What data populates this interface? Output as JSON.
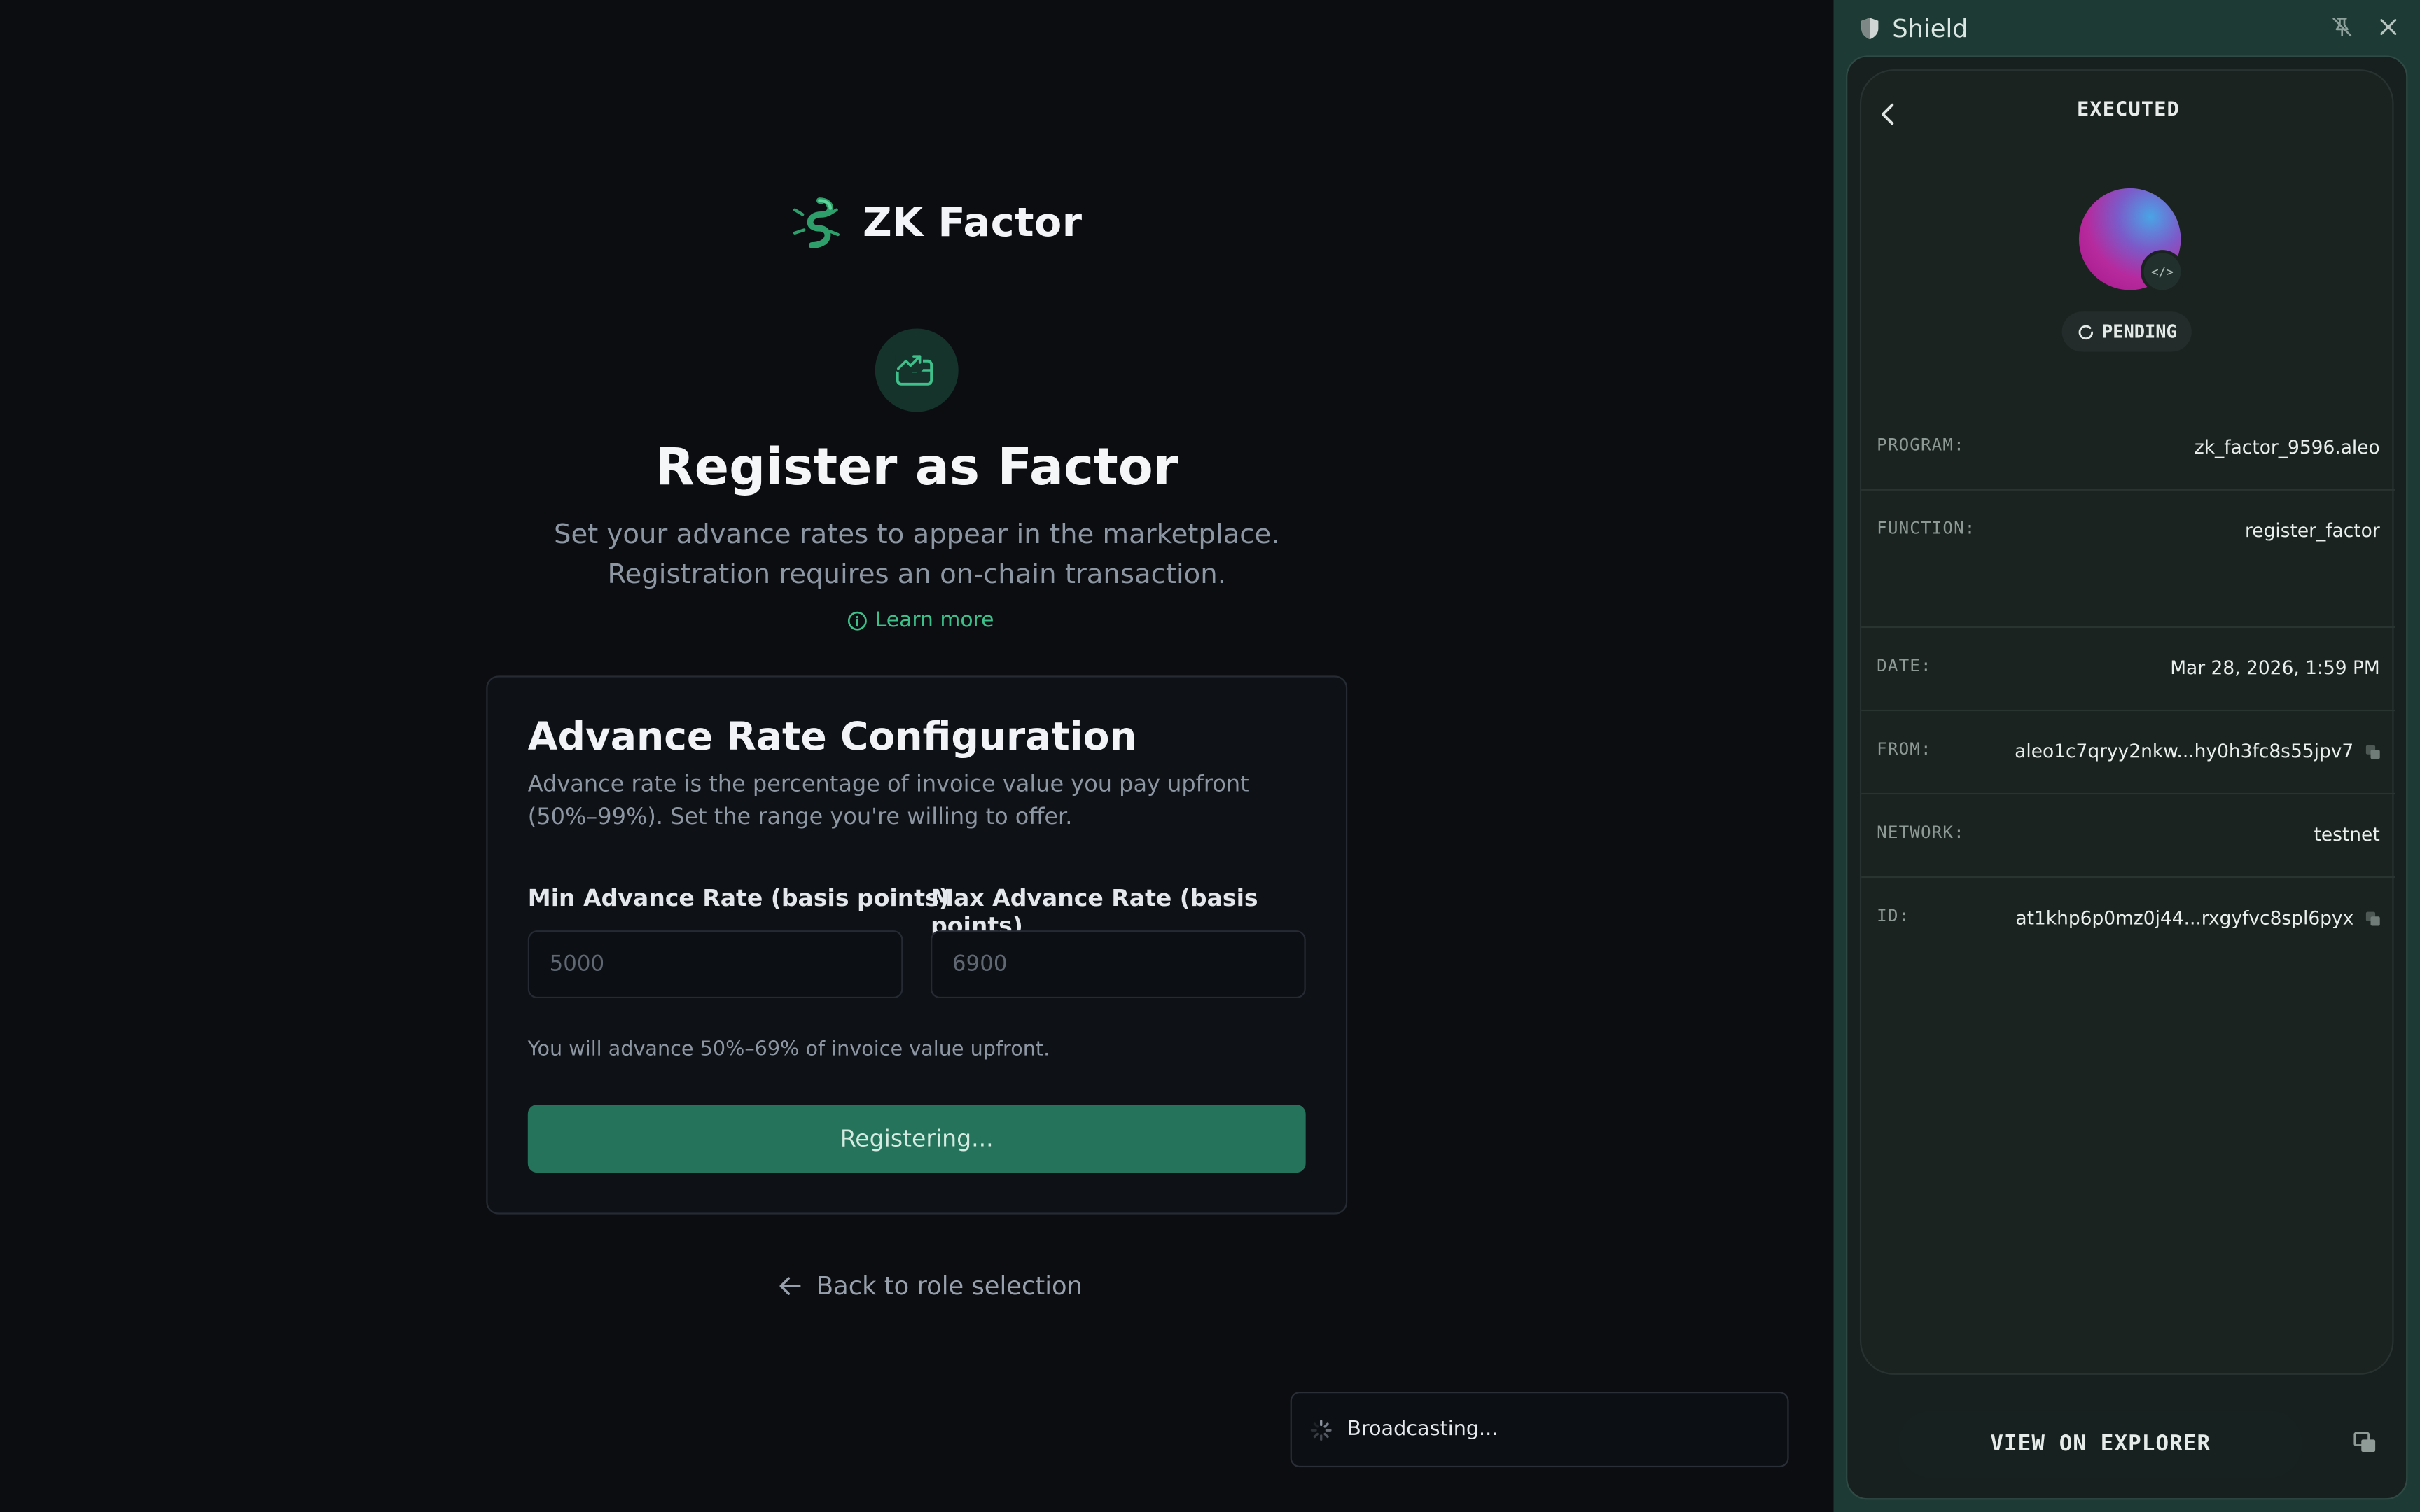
{
  "app": {
    "brand_name": "ZK Factor",
    "page_title": "Register as Factor",
    "page_subtitle": "Set your advance rates to appear in the marketplace. Registration requires an on-chain transaction.",
    "learn_more": "Learn more",
    "card": {
      "title": "Advance Rate Configuration",
      "description": "Advance rate is the percentage of invoice value you pay upfront (50%–99%). Set the range you're willing to offer.",
      "min_label": "Min Advance Rate (basis points)",
      "min_placeholder": "5000",
      "max_label": "Max Advance Rate (basis points)",
      "max_placeholder": "6900",
      "hint": "You will advance 50%–69% of invoice value upfront.",
      "submit_label": "Registering..."
    },
    "back_link": "Back to role selection",
    "toast": "Broadcasting..."
  },
  "wallet": {
    "title": "Shield",
    "status_heading": "EXECUTED",
    "status_badge": "PENDING",
    "rows": [
      {
        "key": "PROGRAM:",
        "value": "zk_factor_9596.aleo"
      },
      {
        "key": "FUNCTION:",
        "value": "register_factor"
      },
      {
        "key": "DATE:",
        "value": "Mar 28, 2026, 1:59 PM"
      },
      {
        "key": "FROM:",
        "value": "aleo1c7qryy2nkw...hy0h3fc8s55jpv7"
      },
      {
        "key": "NETWORK:",
        "value": "testnet"
      },
      {
        "key": "ID:",
        "value": "at1khp6p0mz0j44...rxgyfvc8spl6pyx"
      }
    ],
    "explorer_button": "VIEW ON EXPLORER"
  },
  "colors": {
    "accent": "#3fbf8a",
    "primary_button": "#25735a",
    "wallet_frame": "#1d3b34",
    "background": "#0b0d11"
  },
  "icons": {
    "brand": "gecko-logo-icon",
    "hero": "briefcase-trend-icon",
    "learn_more": "info-circle-icon",
    "back": "arrow-left-icon",
    "toast": "spinner-icon",
    "wallet_title": "shield-icon",
    "pin": "unpin-icon",
    "close": "close-icon",
    "wallet_back": "chevron-left-icon",
    "avatar_badge": "code-icon",
    "pending": "refresh-icon",
    "copy": "copy-icon",
    "expand": "expand-window-icon"
  }
}
